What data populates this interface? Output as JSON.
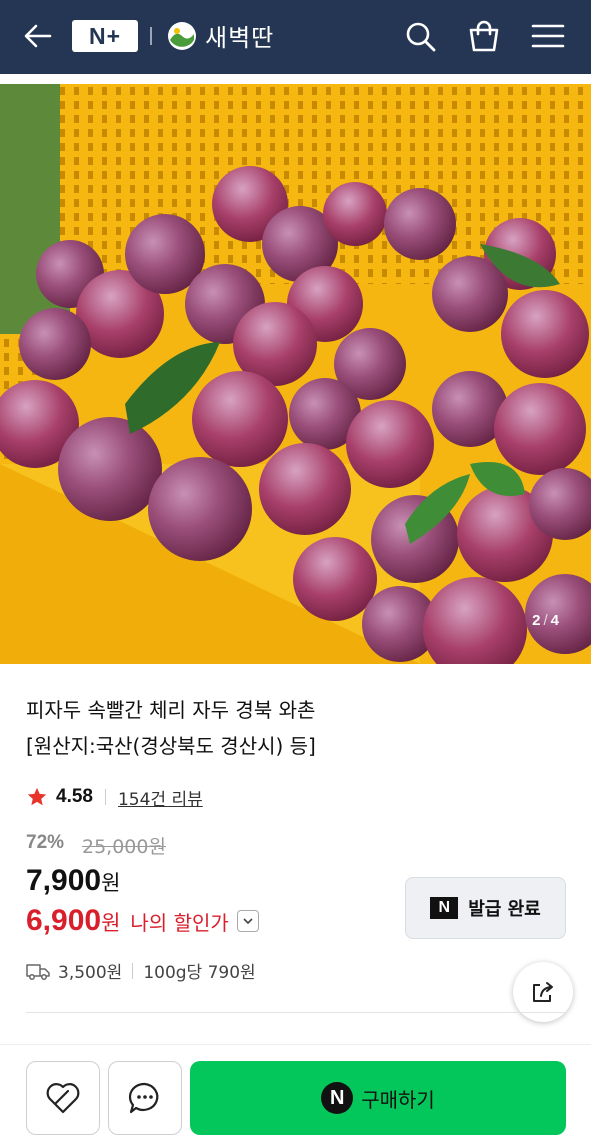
{
  "header": {
    "brand_badge": "N+",
    "store_name": "새벽딴",
    "bg_color": "#243654",
    "icons": [
      "back-arrow-icon",
      "search-icon",
      "shopping-bag-icon",
      "menu-icon"
    ]
  },
  "gallery": {
    "current": "2",
    "total": "4",
    "separator": "/"
  },
  "product": {
    "title_line1": "피자두 속빨간 체리 자두 경북 와촌",
    "title_line2": "[원산지:국산(경상북도 경산시) 등]",
    "rating": "4.58",
    "review_count": "154건 리뷰",
    "discount_rate": "72%",
    "original_price": "25,000원",
    "price_value": "7,900",
    "price_unit": "원",
    "my_price_value": "6,900",
    "my_price_unit": "원",
    "my_price_label": "나의 할인가",
    "coupon_badge": "N",
    "coupon_label": "발급 완료",
    "shipping_fee": "3,500원",
    "unit_price": "100g당 790원",
    "accent_red": "#d81f2b"
  },
  "bottom_bar": {
    "buy_badge": "N",
    "buy_label": "구매하기",
    "buy_color": "#03c75a"
  }
}
